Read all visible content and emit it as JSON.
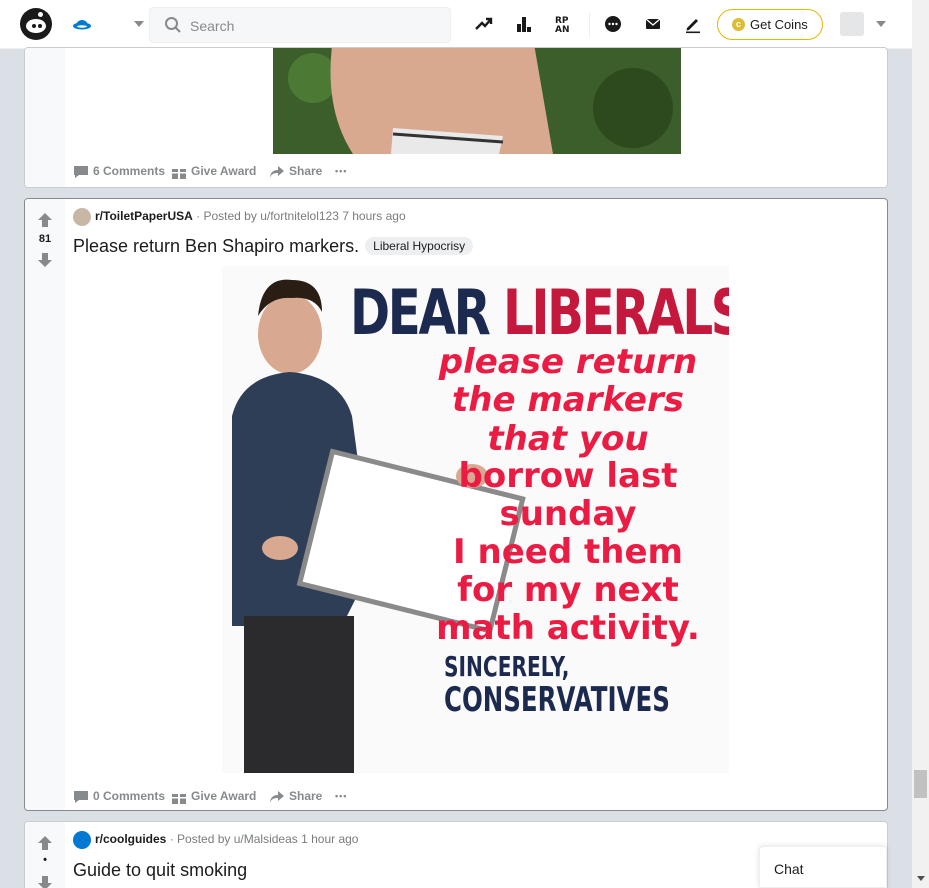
{
  "header": {
    "search_placeholder": "Search",
    "get_coins_label": "Get Coins",
    "coin_symbol": "c",
    "icons": [
      "reddit-logo-icon",
      "home-icon",
      "trending-icon",
      "leaderboard-icon",
      "rpan-icon",
      "chat-icon",
      "mail-icon",
      "pencil-icon",
      "coin-icon",
      "avatar-icon",
      "chevron-down-icon"
    ],
    "rpan_label": "RP AN"
  },
  "posts": [
    {
      "comments_label": "6 Comments",
      "award_label": "Give Award",
      "share_label": "Share",
      "more_label": "•••"
    },
    {
      "score": "81",
      "subreddit": "r/ToiletPaperUSA",
      "posted_by": "· Posted by u/fortnitelol123 7 hours ago",
      "title": "Please return Ben Shapiro markers.",
      "flair": "Liberal Hypocrisy",
      "image_text": {
        "dear": "DEAR ",
        "liberals": "LIBERALS",
        "lines": [
          "please return",
          "the markers",
          "that you",
          "borrow last",
          "sunday",
          "I need them",
          "for my next",
          "math activity."
        ],
        "sincerely": "SINCERELY,",
        "conservatives": "CONSERVATIVES"
      },
      "comments_label": "0 Comments",
      "award_label": "Give Award",
      "share_label": "Share",
      "more_label": "•••"
    },
    {
      "score": "•",
      "subreddit": "r/coolguides",
      "posted_by": "· Posted by u/Malsideas 1 hour ago",
      "title": "Guide to quit smoking"
    }
  ],
  "chat_label": "Chat",
  "colors": {
    "accent": "#0079d3",
    "coin_border": "#e6b800",
    "meme_red": "#ea1c44",
    "meme_navy": "#1b2a4e"
  }
}
